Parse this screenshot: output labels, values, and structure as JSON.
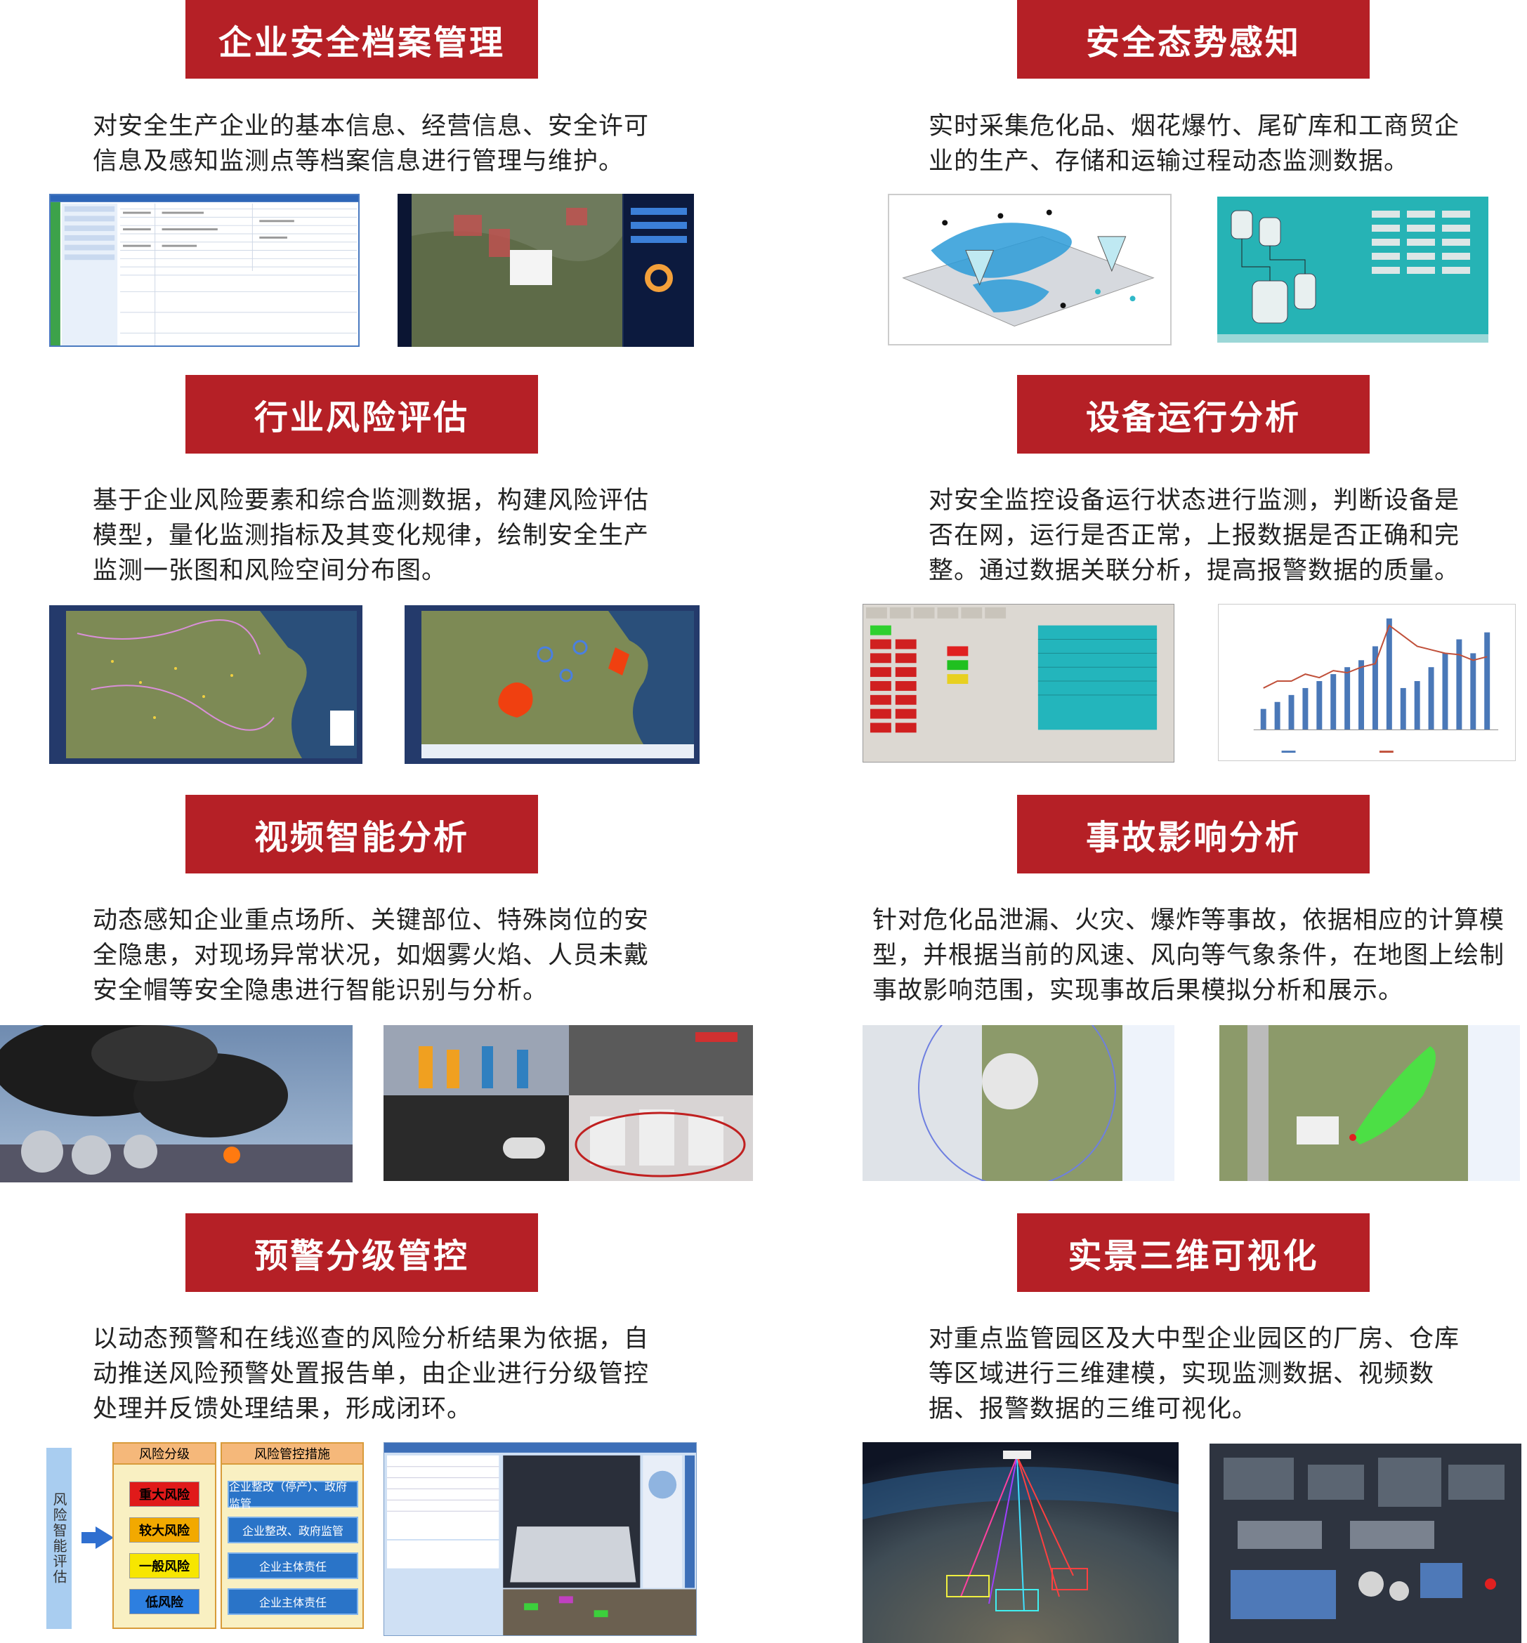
{
  "sections": [
    {
      "title": "企业安全档案管理",
      "lines": [
        "对安全生产企业的基本信息、经营信息、安全许可",
        "信息及感知监测点等档案信息进行管理与维护。"
      ]
    },
    {
      "title": "安全态势感知",
      "lines": [
        "实时采集危化品、烟花爆竹、尾矿库和工商贸企",
        "业的生产、存储和运输过程动态监测数据。"
      ]
    },
    {
      "title": "行业风险评估",
      "lines": [
        "基于企业风险要素和综合监测数据，构建风险评估",
        "模型，量化监测指标及其变化规律，绘制安全生产",
        "监测一张图和风险空间分布图。"
      ]
    },
    {
      "title": "设备运行分析",
      "lines": [
        "对安全监控设备运行状态进行监测，判断设备是",
        "否在网，运行是否正常，上报数据是否正确和完",
        "整。通过数据关联分析，提高报警数据的质量。"
      ]
    },
    {
      "title": "视频智能分析",
      "lines": [
        "动态感知企业重点场所、关键部位、特殊岗位的安",
        "全隐患，对现场异常状况，如烟雾火焰、人员未戴",
        "安全帽等安全隐患进行智能识别与分析。"
      ]
    },
    {
      "title": "事故影响分析",
      "lines": [
        "针对危化品泄漏、火灾、爆炸等事故，依据相应的计算模",
        "型，并根据当前的风速、风向等气象条件，在地图上绘制",
        "事故影响范围，实现事故后果模拟分析和展示。"
      ]
    },
    {
      "title": "预警分级管控",
      "lines": [
        "以动态预警和在线巡查的风险分析结果为依据，自",
        "动推送风险预警处置报告单，由企业进行分级管控",
        "处理并反馈处理结果，形成闭环。"
      ]
    },
    {
      "title": "实景三维可视化",
      "lines": [
        "对重点监管园区及大中型企业园区的厂房、仓库",
        "等区域进行三维建模，实现监测数据、视频数",
        "据、报警数据的三维可视化。"
      ]
    }
  ],
  "flow": {
    "side_label": "风险智能评估",
    "levels_header": "风险分级",
    "measures_header": "风险管控措施",
    "levels": [
      {
        "label": "重大风险",
        "color": "#e01a1a",
        "text_color": "#000000"
      },
      {
        "label": "较大风险",
        "color": "#f2a900",
        "text_color": "#000000"
      },
      {
        "label": "一般风险",
        "color": "#f7e600",
        "text_color": "#000000"
      },
      {
        "label": "低风险",
        "color": "#2d7fe0",
        "text_color": "#000000"
      }
    ],
    "measures": [
      "企业整改（停产）、政府监管",
      "企业整改、政府监管",
      "企业主体责任",
      "企业主体责任"
    ]
  },
  "colors": {
    "accent": "#b52026"
  }
}
